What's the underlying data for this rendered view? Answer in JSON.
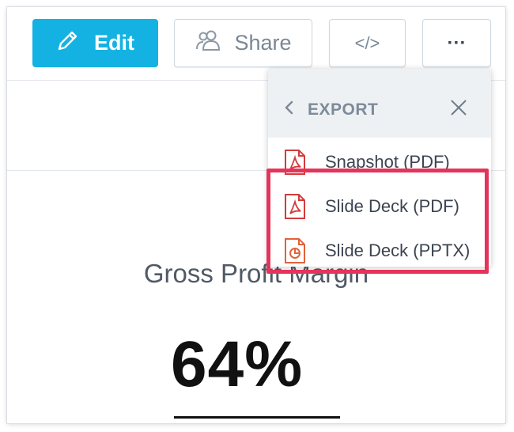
{
  "toolbar": {
    "edit_label": "Edit",
    "share_label": "Share",
    "embed_label": "</>",
    "more_label": "···"
  },
  "export_menu": {
    "title": "EXPORT",
    "items": [
      {
        "label": "Snapshot (PDF)",
        "icon": "pdf-file-icon"
      },
      {
        "label": "Slide Deck (PDF)",
        "icon": "pdf-file-icon"
      },
      {
        "label": "Slide Deck (PPTX)",
        "icon": "pptx-file-icon"
      }
    ]
  },
  "insight": {
    "title": "Gross Profit Margin",
    "value": "64%"
  },
  "colors": {
    "accent": "#14b2e2",
    "highlight": "#e5345b",
    "pdf_icon": "#d43a3a",
    "pptx_icon": "#e0623a"
  }
}
